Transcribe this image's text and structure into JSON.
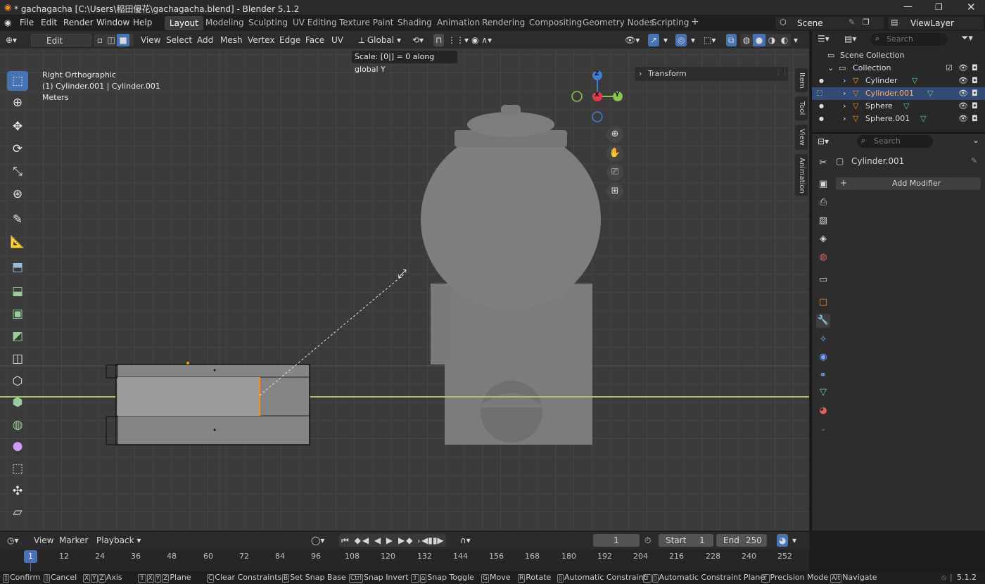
{
  "titlebar": {
    "title": "* gachagacha [C:\\Users\\稲田優花\\gachagacha.blend] - Blender 5.1.2"
  },
  "menu": {
    "items": [
      "File",
      "Edit",
      "Render",
      "Window",
      "Help"
    ]
  },
  "workspaces": [
    "Layout",
    "Modeling",
    "Sculpting",
    "UV Editing",
    "Texture Paint",
    "Shading",
    "Animation",
    "Rendering",
    "Compositing",
    "Geometry Nodes",
    "Scripting"
  ],
  "topright": {
    "scene": "Scene",
    "viewlayer": "ViewLayer"
  },
  "viewport_header": {
    "mode": "Edit Mode",
    "menus": [
      "View",
      "Select",
      "Add",
      "Mesh",
      "Vertex",
      "Edge",
      "Face",
      "UV"
    ],
    "orientation": "Global"
  },
  "viewport": {
    "view_name": "Right Orthographic",
    "object": "(1) Cylinder.001 | Cylinder.001",
    "units": "Meters",
    "operator_status": "Scale: [0|] = 0  along global Y",
    "panel_transform": "Transform",
    "tabs": [
      "Item",
      "Tool",
      "View",
      "Animation"
    ],
    "gizmo_axes": [
      "Z",
      "X",
      "Y"
    ]
  },
  "outliner": {
    "search_placeholder": "Search",
    "scene_collection": "Scene Collection",
    "collection": "Collection",
    "objects": [
      "Cylinder",
      "Cylinder.001",
      "Sphere",
      "Sphere.001"
    ]
  },
  "properties": {
    "search_placeholder": "Search",
    "object_name": "Cylinder.001",
    "add_modifier": "Add Modifier"
  },
  "timeline": {
    "menus": [
      "View",
      "Marker",
      "Playback"
    ],
    "current_frame": "1",
    "start_label": "Start",
    "start": "1",
    "end_label": "End",
    "end": "250",
    "ruler": [
      "1",
      "12",
      "24",
      "36",
      "48",
      "60",
      "72",
      "84",
      "96",
      "108",
      "120",
      "132",
      "144",
      "156",
      "168",
      "180",
      "192",
      "204",
      "216",
      "228",
      "240",
      "252"
    ]
  },
  "statusbar": {
    "items": [
      "Confirm",
      "Cancel",
      "Axis",
      "Plane",
      "Clear Constraints",
      "Set Snap Base",
      "Snap Invert",
      "Snap Toggle",
      "Move",
      "Rotate",
      "Automatic Constraint",
      "Automatic Constraint Plane",
      "Precision Mode",
      "Navigate"
    ],
    "version": "5.1.2"
  },
  "colors": {
    "accent": "#4772b3",
    "selected_row": "#334a75",
    "x_axis": "#e0394e",
    "y_axis": "#8bc34a",
    "z_axis": "#3d7fd6",
    "edit_edge": "#ff8c1a"
  }
}
